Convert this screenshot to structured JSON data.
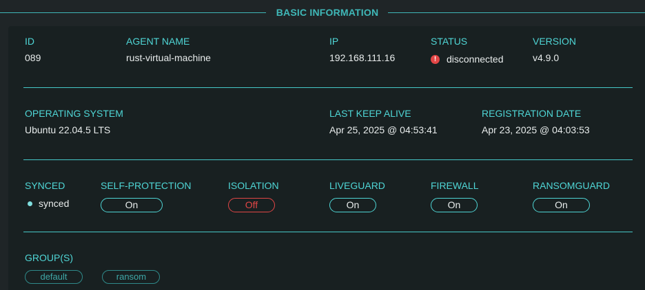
{
  "section": {
    "title": "BASIC INFORMATION"
  },
  "row1": {
    "id": {
      "label": "ID",
      "value": "089"
    },
    "agent_name": {
      "label": "AGENT NAME",
      "value": "rust-virtual-machine"
    },
    "ip": {
      "label": "IP",
      "value": "192.168.111.16"
    },
    "status": {
      "label": "STATUS",
      "value": "disconnected",
      "icon": "alert-icon",
      "icon_glyph": "!"
    },
    "version": {
      "label": "VERSION",
      "value": "v4.9.0"
    }
  },
  "row2": {
    "os": {
      "label": "OPERATING SYSTEM",
      "value": "Ubuntu 22.04.5 LTS"
    },
    "keep_alive": {
      "label": "LAST KEEP ALIVE",
      "value": "Apr 25, 2025 @ 04:53:41"
    },
    "registration": {
      "label": "REGISTRATION DATE",
      "value": "Apr 23, 2025 @ 04:03:53"
    }
  },
  "row3": {
    "synced": {
      "label": "SYNCED",
      "value": "synced"
    },
    "self_protection": {
      "label": "SELF-PROTECTION",
      "value": "On"
    },
    "isolation": {
      "label": "ISOLATION",
      "value": "Off"
    },
    "liveguard": {
      "label": "LIVEGUARD",
      "value": "On"
    },
    "firewall": {
      "label": "FIREWALL",
      "value": "On"
    },
    "ransomguard": {
      "label": "RANSOMGUARD",
      "value": "On"
    }
  },
  "groups": {
    "label": "GROUP(S)",
    "items": [
      "default",
      "ransom"
    ]
  },
  "colors": {
    "accent": "#4fd6d6",
    "danger": "#e24646",
    "card_bg": "#182021",
    "page_bg": "#1f2527"
  }
}
